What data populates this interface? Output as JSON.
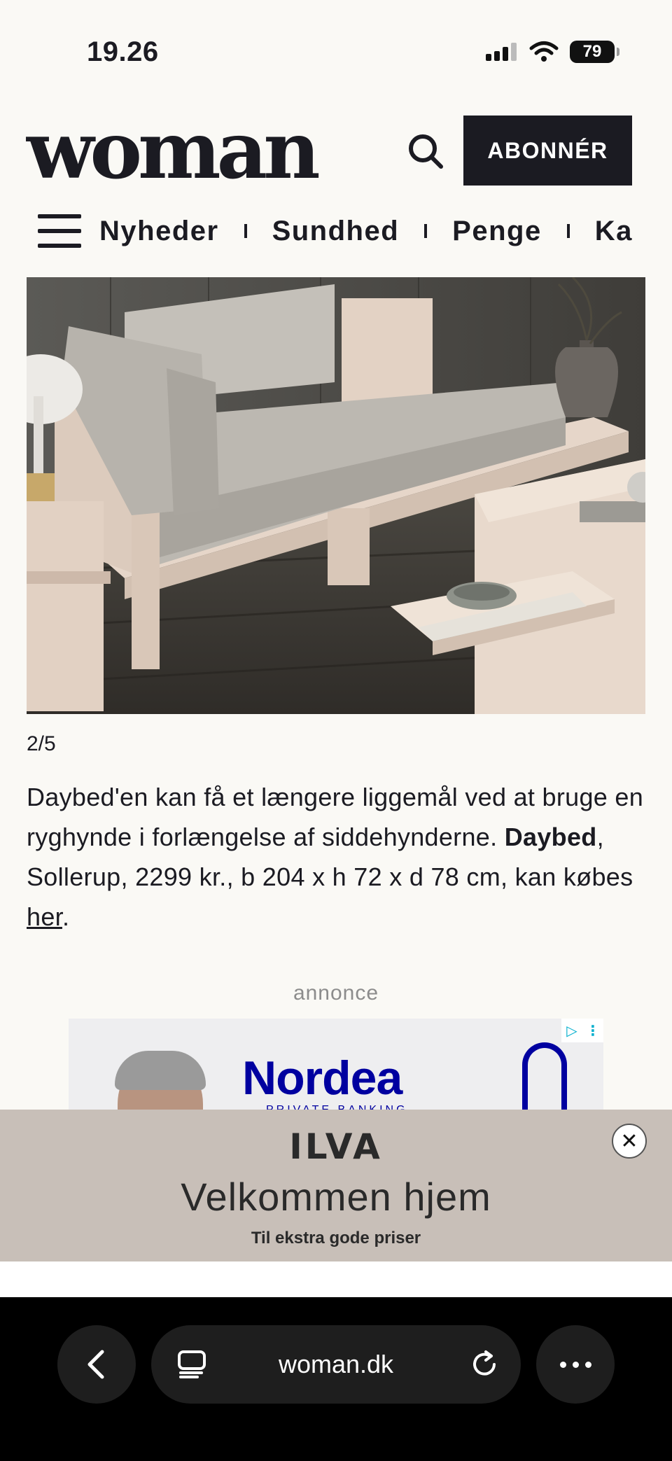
{
  "status_bar": {
    "time": "19.26",
    "battery": "79"
  },
  "header": {
    "logo": "woman",
    "subscribe_label": "ABONNÉR"
  },
  "nav": {
    "items": [
      "Nyheder",
      "Sundhed",
      "Penge",
      "Ka"
    ]
  },
  "gallery": {
    "counter": "2/5",
    "caption_text_1": "Daybed'en kan få et længere liggemål ved at bruge en ryghynde i forlængelse af siddehynderne. ",
    "caption_bold": "Daybed",
    "caption_text_2": ", Sollerup, 2299 kr., b 204 x h 72 x d 78 cm, kan købes ",
    "caption_link": "her",
    "caption_end": "."
  },
  "ad": {
    "label": "annonce",
    "nordea_brand": "Nordea",
    "nordea_sub": "PRIVATE BANKING"
  },
  "ilva_banner": {
    "logo": "ILVA",
    "headline": "Velkommen hjem",
    "subline": "Til ekstra gode priser"
  },
  "browser": {
    "url": "woman.dk"
  },
  "colors": {
    "accent": "#1b1b22",
    "background": "#faf9f5",
    "banner": "#c8bfb8",
    "nordea": "#0000a0"
  }
}
